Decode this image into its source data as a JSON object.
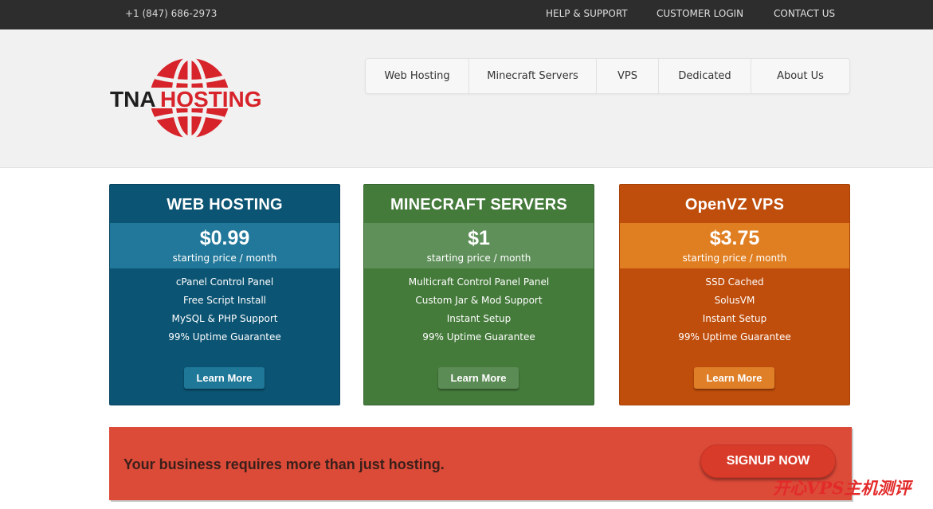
{
  "topbar": {
    "phone": "+1 (847) 686-2973",
    "links": [
      "HELP & SUPPORT",
      "CUSTOMER LOGIN",
      "CONTACT US"
    ]
  },
  "logo": {
    "text_left": "TNA",
    "text_right": "HOSTING",
    "colors": {
      "dark": "#1f1f1f",
      "red": "#d7232a"
    }
  },
  "nav": {
    "items": [
      "Web Hosting",
      "Minecraft Servers",
      "VPS",
      "Dedicated",
      "About Us"
    ]
  },
  "plans": [
    {
      "title": "WEB HOSTING",
      "price": "$0.99",
      "price_label": "starting price / month",
      "features": [
        "cPanel Control Panel",
        "Free Script Install",
        "MySQL & PHP Support",
        "99% Uptime Guarantee"
      ],
      "button": "Learn More",
      "color": "#0b5473"
    },
    {
      "title": "MINECRAFT SERVERS",
      "price": "$1",
      "price_label": "starting price / month",
      "features": [
        "Multicraft Control Panel Panel",
        "Custom Jar & Mod Support",
        "Instant Setup",
        "99% Uptime Guarantee"
      ],
      "button": "Learn More",
      "color": "#447a3a"
    },
    {
      "title": "OpenVZ VPS",
      "price": "$3.75",
      "price_label": "starting price / month",
      "features": [
        "SSD Cached",
        "SolusVM",
        "Instant Setup",
        "99% Uptime Guarantee"
      ],
      "button": "Learn More",
      "color": "#bf4d0b"
    }
  ],
  "cta": {
    "text": "Your business requires more than just hosting.",
    "button": "SIGNUP NOW",
    "color": "#dc4a38"
  },
  "watermark": "开心VPS主机测评"
}
